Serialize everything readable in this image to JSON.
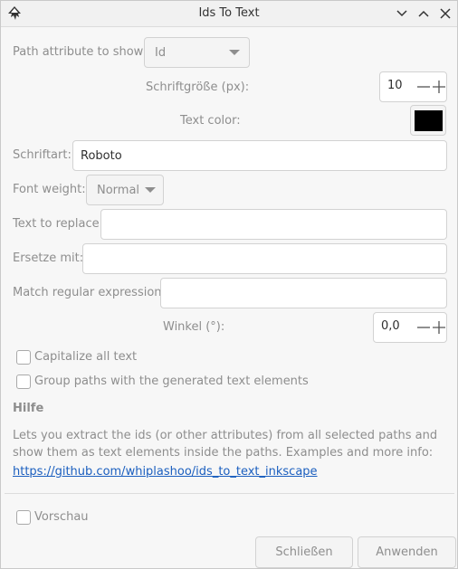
{
  "window": {
    "title": "Ids To Text",
    "buttons": [
      "minimize",
      "maximize",
      "close"
    ]
  },
  "form": {
    "path_attribute": {
      "label": "Path attribute to show:",
      "value": "Id"
    },
    "font_size": {
      "label": "Schriftgröße (px):",
      "value": "10"
    },
    "text_color": {
      "label": "Text color:",
      "value": "#000000"
    },
    "font_family": {
      "label": "Schriftart:",
      "value": "Roboto"
    },
    "font_weight": {
      "label": "Font weight:",
      "value": "Normal"
    },
    "text_to_replace": {
      "label": "Text to replace:",
      "value": ""
    },
    "replace_with": {
      "label": "Ersetze mit:",
      "value": ""
    },
    "match_regex": {
      "label": "Match regular expression:",
      "value": ""
    },
    "angle": {
      "label": "Winkel (°):",
      "value": "0,0"
    },
    "capitalize": {
      "label": "Capitalize all text",
      "checked": false
    },
    "group_paths": {
      "label": "Group paths with the generated text elements",
      "checked": false
    }
  },
  "help": {
    "heading": "Hilfe",
    "description": "Lets you extract the ids (or other attributes) from all selected paths and show them as text elements inside the paths. Examples and more info:",
    "link": "https://github.com/whiplashoo/ids_to_text_inkscape"
  },
  "footer": {
    "preview": {
      "label": "Vorschau",
      "checked": false
    },
    "close_label": "Schließen",
    "apply_label": "Anwenden"
  }
}
